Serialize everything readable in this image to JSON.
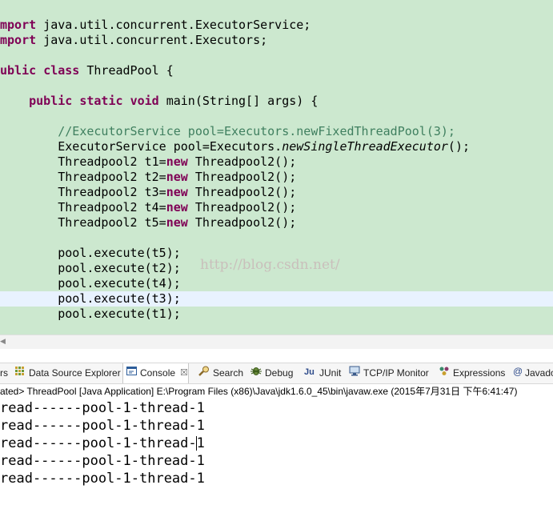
{
  "editor": {
    "lines": [
      {
        "segs": [
          {
            "t": "mport",
            "c": "kw"
          },
          {
            "t": " java.util.concurrent.ExecutorService;"
          }
        ]
      },
      {
        "segs": [
          {
            "t": "mport",
            "c": "kw"
          },
          {
            "t": " java.util.concurrent.Executors;"
          }
        ]
      },
      {
        "segs": [
          {
            "t": ""
          }
        ]
      },
      {
        "segs": [
          {
            "t": "ublic",
            "c": "kw"
          },
          {
            "t": " "
          },
          {
            "t": "class",
            "c": "kw"
          },
          {
            "t": " ThreadPool {"
          }
        ]
      },
      {
        "segs": [
          {
            "t": ""
          }
        ]
      },
      {
        "segs": [
          {
            "t": "    "
          },
          {
            "t": "public",
            "c": "kw"
          },
          {
            "t": " "
          },
          {
            "t": "static",
            "c": "kw"
          },
          {
            "t": " "
          },
          {
            "t": "void",
            "c": "kw"
          },
          {
            "t": " main(String[] args) {"
          }
        ]
      },
      {
        "segs": [
          {
            "t": ""
          }
        ]
      },
      {
        "segs": [
          {
            "t": "        "
          },
          {
            "t": "//ExecutorService pool=Executors.newFixedThreadPool(3);",
            "c": "cm"
          }
        ]
      },
      {
        "segs": [
          {
            "t": "        ExecutorService pool=Executors."
          },
          {
            "t": "newSingleThreadExecutor",
            "c": "it"
          },
          {
            "t": "();"
          }
        ]
      },
      {
        "segs": [
          {
            "t": "        Threadpool2 t1="
          },
          {
            "t": "new",
            "c": "kw"
          },
          {
            "t": " Threadpool2();"
          }
        ]
      },
      {
        "segs": [
          {
            "t": "        Threadpool2 t2="
          },
          {
            "t": "new",
            "c": "kw"
          },
          {
            "t": " Threadpool2();"
          }
        ]
      },
      {
        "segs": [
          {
            "t": "        Threadpool2 t3="
          },
          {
            "t": "new",
            "c": "kw"
          },
          {
            "t": " Threadpool2();"
          }
        ]
      },
      {
        "segs": [
          {
            "t": "        Threadpool2 t4="
          },
          {
            "t": "new",
            "c": "kw"
          },
          {
            "t": " Threadpool2();"
          }
        ]
      },
      {
        "segs": [
          {
            "t": "        Threadpool2 t5="
          },
          {
            "t": "new",
            "c": "kw"
          },
          {
            "t": " Threadpool2();"
          }
        ]
      },
      {
        "segs": [
          {
            "t": ""
          }
        ]
      },
      {
        "segs": [
          {
            "t": "        pool.execute(t5);"
          }
        ]
      },
      {
        "segs": [
          {
            "t": "        pool.execute(t2);"
          }
        ]
      },
      {
        "segs": [
          {
            "t": "        pool.execute(t4);"
          }
        ]
      },
      {
        "segs": [
          {
            "t": "        pool.execute(t3);"
          }
        ],
        "current": true
      },
      {
        "segs": [
          {
            "t": "        pool.execute(t1);"
          }
        ]
      }
    ],
    "watermark": "http://blog.csdn.net/"
  },
  "tabs": [
    {
      "id": "rs",
      "label": "rs",
      "icon": "",
      "active": false
    },
    {
      "id": "data-source-explorer",
      "label": "Data Source Explorer",
      "icon": "data-source-explorer-icon",
      "active": false
    },
    {
      "id": "console",
      "label": "Console",
      "icon": "console-icon",
      "active": true
    },
    {
      "id": "search",
      "label": "Search",
      "icon": "search-icon",
      "active": false
    },
    {
      "id": "debug",
      "label": "Debug",
      "icon": "debug-icon",
      "active": false
    },
    {
      "id": "junit",
      "label": "JUnit",
      "icon": "junit-icon",
      "active": false
    },
    {
      "id": "tcpip-monitor",
      "label": "TCP/IP Monitor",
      "icon": "tcpip-monitor-icon",
      "active": false
    },
    {
      "id": "expressions",
      "label": "Expressions",
      "icon": "expressions-icon",
      "active": false
    },
    {
      "id": "javadoc",
      "label": "Javado",
      "icon": "javadoc-icon",
      "active": false
    }
  ],
  "console": {
    "status": "ated> ThreadPool [Java Application] E:\\Program Files (x86)\\Java\\jdk1.6.0_45\\bin\\javaw.exe (2015年7月31日 下午6:41:47)",
    "output": [
      "read------pool-1-thread-1",
      "read------pool-1-thread-1",
      "read------pool-1-thread-1",
      "read------pool-1-thread-1",
      "read------pool-1-thread-1"
    ]
  },
  "colors": {
    "editor_bg": "#cce8cf",
    "keyword": "#7f0055",
    "comment": "#3f7f5f",
    "current_line": "#e8f2fe"
  }
}
